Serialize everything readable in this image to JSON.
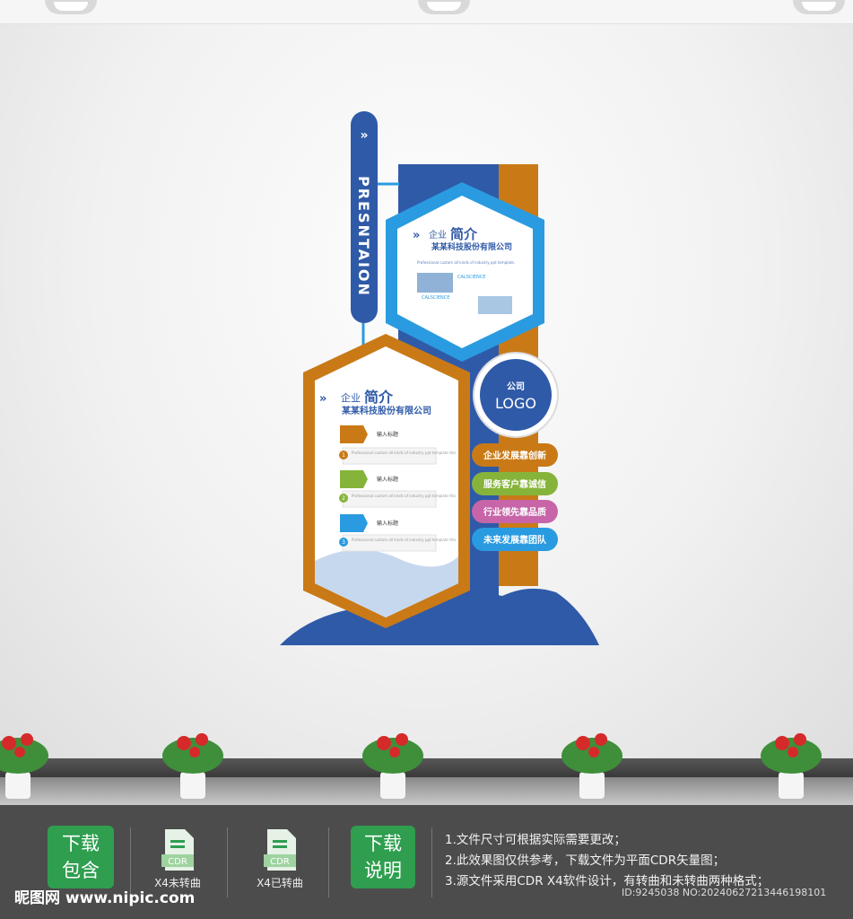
{
  "sign": {
    "vertical_title": "PRESNTAION",
    "panel_top": {
      "title_small": "企业",
      "title_large": "简介",
      "company": "某某科技股份有限公司",
      "body": "Professional custom all kinds of industry ppt template,",
      "caption1": "CALSCIENCE",
      "caption2": "CALSCIENCE"
    },
    "panel_left": {
      "title_small": "企业",
      "title_large": "简介",
      "company": "某某科技股份有限公司",
      "items": [
        {
          "num": "1",
          "label": "输入标题",
          "text": "Professional custom all kinds of industry ppt template this"
        },
        {
          "num": "2",
          "label": "输入标题",
          "text": "Professional custom all kinds of industry ppt template this"
        },
        {
          "num": "3",
          "label": "输入标题",
          "text": "Professional custom all kinds of industry ppt template this"
        }
      ]
    },
    "logo": {
      "top": "公司",
      "bottom": "LOGO"
    },
    "tags": [
      {
        "text": "企业发展靠创新",
        "color": "#c8730f"
      },
      {
        "text": "服务客户靠诚信",
        "color": "#86b43a"
      },
      {
        "text": "行业领先靠品质",
        "color": "#c765a8"
      },
      {
        "text": "未来发展靠团队",
        "color": "#2a9be0"
      }
    ],
    "colors": {
      "navy": "#2f5aa8",
      "orange": "#c97a17",
      "blue": "#2a9be0"
    }
  },
  "footer": {
    "btn_download_contents": "下载包含",
    "file1_label": "X4未转曲",
    "file2_label": "X4已转曲",
    "btn_download_notes": "下载说明",
    "notes": [
      "1.文件尺寸可根据实际需要更改；",
      "2.此效果图仅供参考，下载文件为平面CDR矢量图；",
      "3.源文件采用CDR X4软件设计，有转曲和未转曲两种格式；"
    ],
    "file_badge": "CDR",
    "brand": "昵图网 www.nipic.com",
    "id_text": "ID:9245038 NO:20240627213446198101"
  }
}
